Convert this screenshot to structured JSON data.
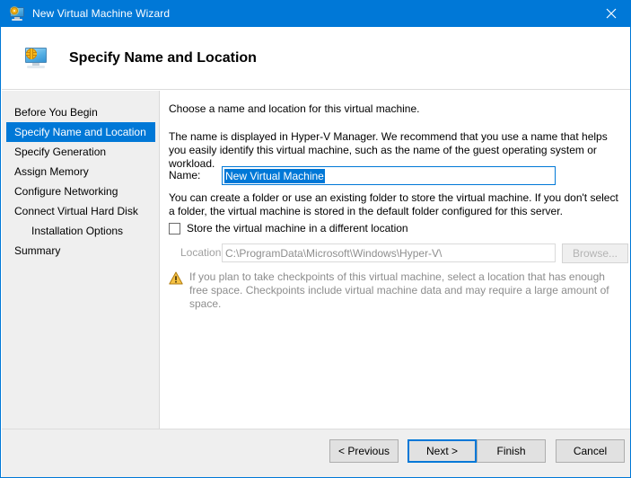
{
  "window": {
    "title": "New Virtual Machine Wizard",
    "title_icon": "virtual-machine-icon",
    "close_icon": "close-icon",
    "accent_color": "#0078d7",
    "titlebar_bg": "#0078d7",
    "panel_bg": "#efefef"
  },
  "header": {
    "icon": "virtual-machine-icon",
    "title": "Specify Name and Location"
  },
  "sidebar": {
    "items": [
      {
        "label": "Before You Begin",
        "selected": false,
        "indent": false
      },
      {
        "label": "Specify Name and Location",
        "selected": true,
        "indent": false
      },
      {
        "label": "Specify Generation",
        "selected": false,
        "indent": false
      },
      {
        "label": "Assign Memory",
        "selected": false,
        "indent": false
      },
      {
        "label": "Configure Networking",
        "selected": false,
        "indent": false
      },
      {
        "label": "Connect Virtual Hard Disk",
        "selected": false,
        "indent": false
      },
      {
        "label": "Installation Options",
        "selected": false,
        "indent": true
      },
      {
        "label": "Summary",
        "selected": false,
        "indent": false
      }
    ]
  },
  "content": {
    "intro": "Choose a name and location for this virtual machine.",
    "description": "The name is displayed in Hyper-V Manager. We recommend that you use a name that helps you easily identify this virtual machine, such as the name of the guest operating system or workload.",
    "name_label": "Name:",
    "name_value": "New Virtual Machine",
    "name_selected": true,
    "folder_description": "You can create a folder or use an existing folder to store the virtual machine. If you don't select a folder, the virtual machine is stored in the default folder configured for this server.",
    "store_different_location_label": "Store the virtual machine in a different location",
    "store_different_location_checked": false,
    "location_label": "Location:",
    "location_value": "C:\\ProgramData\\Microsoft\\Windows\\Hyper-V\\",
    "location_enabled": false,
    "browse_label": "Browse...",
    "browse_enabled": false,
    "warning_icon": "warning-triangle-icon",
    "warning_text": "If you plan to take checkpoints of this virtual machine, select a location that has enough free space. Checkpoints include virtual machine data and may require a large amount of space."
  },
  "footer": {
    "previous_label": "< Previous",
    "next_label": "Next >",
    "finish_label": "Finish",
    "cancel_label": "Cancel",
    "default_button": "Next >"
  }
}
